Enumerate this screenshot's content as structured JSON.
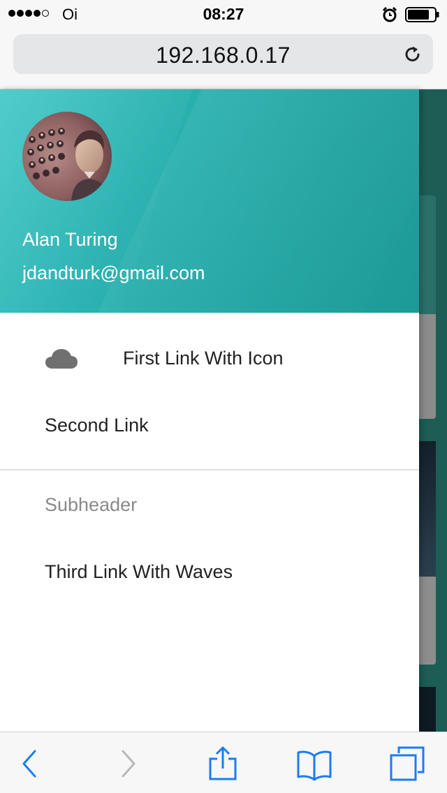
{
  "status_bar": {
    "carrier": "Oi",
    "time": "08:27",
    "signal_bars_filled": 4,
    "signal_bars_total": 5,
    "icons": [
      "alarm-icon",
      "battery-icon"
    ]
  },
  "browser": {
    "url": "192.168.0.17",
    "icons": [
      "reload-icon"
    ]
  },
  "drawer": {
    "header_color": "#26acab",
    "user": {
      "name": "Alan Turing",
      "email": "jdandturk@gmail.com"
    },
    "links": [
      {
        "label": "First Link With Icon",
        "icon": "cloud-icon"
      },
      {
        "label": "Second Link"
      }
    ],
    "subheader": "Subheader",
    "links_after_subheader": [
      {
        "label": "Third Link With Waves"
      }
    ]
  },
  "toolbar": {
    "accent_color": "#1a7cf5",
    "buttons": [
      "back-icon",
      "forward-icon",
      "share-icon",
      "bookmarks-icon",
      "tabs-icon"
    ]
  }
}
